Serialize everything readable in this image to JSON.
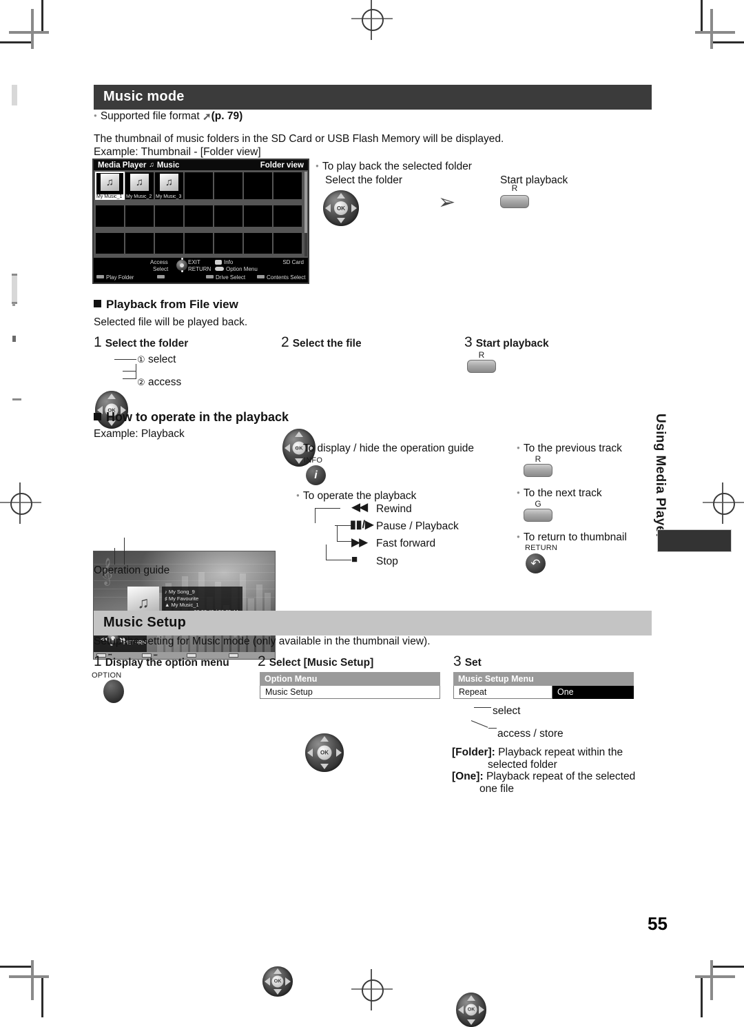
{
  "page": {
    "number": "55",
    "side_tab": "Using Media Player"
  },
  "sections": {
    "music_mode": {
      "title": "Music mode",
      "supported_format": "Supported file format",
      "supported_format_ref": "(p. 79)",
      "intro_line1": "The thumbnail of music folders in the SD Card or USB Flash Memory will be displayed.",
      "intro_line2": "Example: Thumbnail - [Folder view]"
    },
    "playback_file_view": {
      "heading": "Playback from File view",
      "desc": "Selected file will be played back.",
      "steps": [
        {
          "num": "1",
          "label": "Select the folder",
          "a": "select",
          "b": "access"
        },
        {
          "num": "2",
          "label": "Select the file"
        },
        {
          "num": "3",
          "label": "Start playback",
          "key": "R"
        }
      ]
    },
    "how_to_operate": {
      "heading": "How to operate in the playback",
      "example": "Example: Playback",
      "operation_guide_caption": "Operation guide",
      "display_hide": "To display / hide the operation guide",
      "info_label": "INFO",
      "operate_playback": "To operate the playback",
      "controls": [
        {
          "icon": "rewind",
          "label": "Rewind"
        },
        {
          "icon": "pause-play",
          "label": "Pause / Playback"
        },
        {
          "icon": "fast-forward",
          "label": "Fast forward"
        },
        {
          "icon": "stop",
          "label": "Stop"
        }
      ],
      "previous_track": "To the previous track",
      "previous_key": "R",
      "next_track": "To the next track",
      "next_key": "G",
      "return_thumbnail": "To return to thumbnail",
      "return_label": "RETURN"
    },
    "music_setup": {
      "title": "Music Setup",
      "desc": "Setup the setting for Music mode (only available in the thumbnail view).",
      "steps": [
        {
          "num": "1",
          "label": "Display the option menu",
          "button_label": "OPTION"
        },
        {
          "num": "2",
          "label": "Select [Music Setup]"
        },
        {
          "num": "3",
          "label": "Set"
        }
      ],
      "option_menu": {
        "header": "Option Menu",
        "row": "Music Setup"
      },
      "setup_menu": {
        "header": "Music Setup Menu",
        "row": "Repeat",
        "value": "One"
      },
      "dpad_select": "select",
      "dpad_access": "access / store",
      "notes": [
        {
          "key": "[Folder]:",
          "text": "Playback repeat within the",
          "text2": "selected folder"
        },
        {
          "key": "[One]:",
          "text": "Playback repeat of the selected",
          "text2": "one file"
        }
      ]
    }
  },
  "tv_folder_view": {
    "header_app": "Media Player",
    "header_mode": "Music",
    "header_view": "Folder view",
    "thumbnails": [
      "My Music_1",
      "My Music_2",
      "My Music_3"
    ],
    "guide": {
      "access": "Access",
      "select": "Select",
      "exit": "EXIT",
      "return": "RETURN",
      "info": "Info",
      "option_menu": "Option Menu",
      "drive": "SD Card",
      "play_folder": "Play Folder",
      "drive_select": "Drive Select",
      "contents_select": "Contents Select"
    }
  },
  "tv_playback": {
    "track": "My Song_9",
    "album": "My Favourite",
    "folder": "My Music_1",
    "time": "00:02.43 / 00:05.44",
    "guide": {
      "exit": "EXIT",
      "return": "RETURN"
    }
  },
  "to_play_back": {
    "title": "To play back the selected folder",
    "select_folder": "Select the folder",
    "start_playback": "Start playback",
    "key": "R"
  },
  "colors": {
    "header_dark": "#3b3b3b",
    "header_gray": "#c4c4c4",
    "menu_header": "#9a9a9a",
    "tab_black": "#333333"
  }
}
